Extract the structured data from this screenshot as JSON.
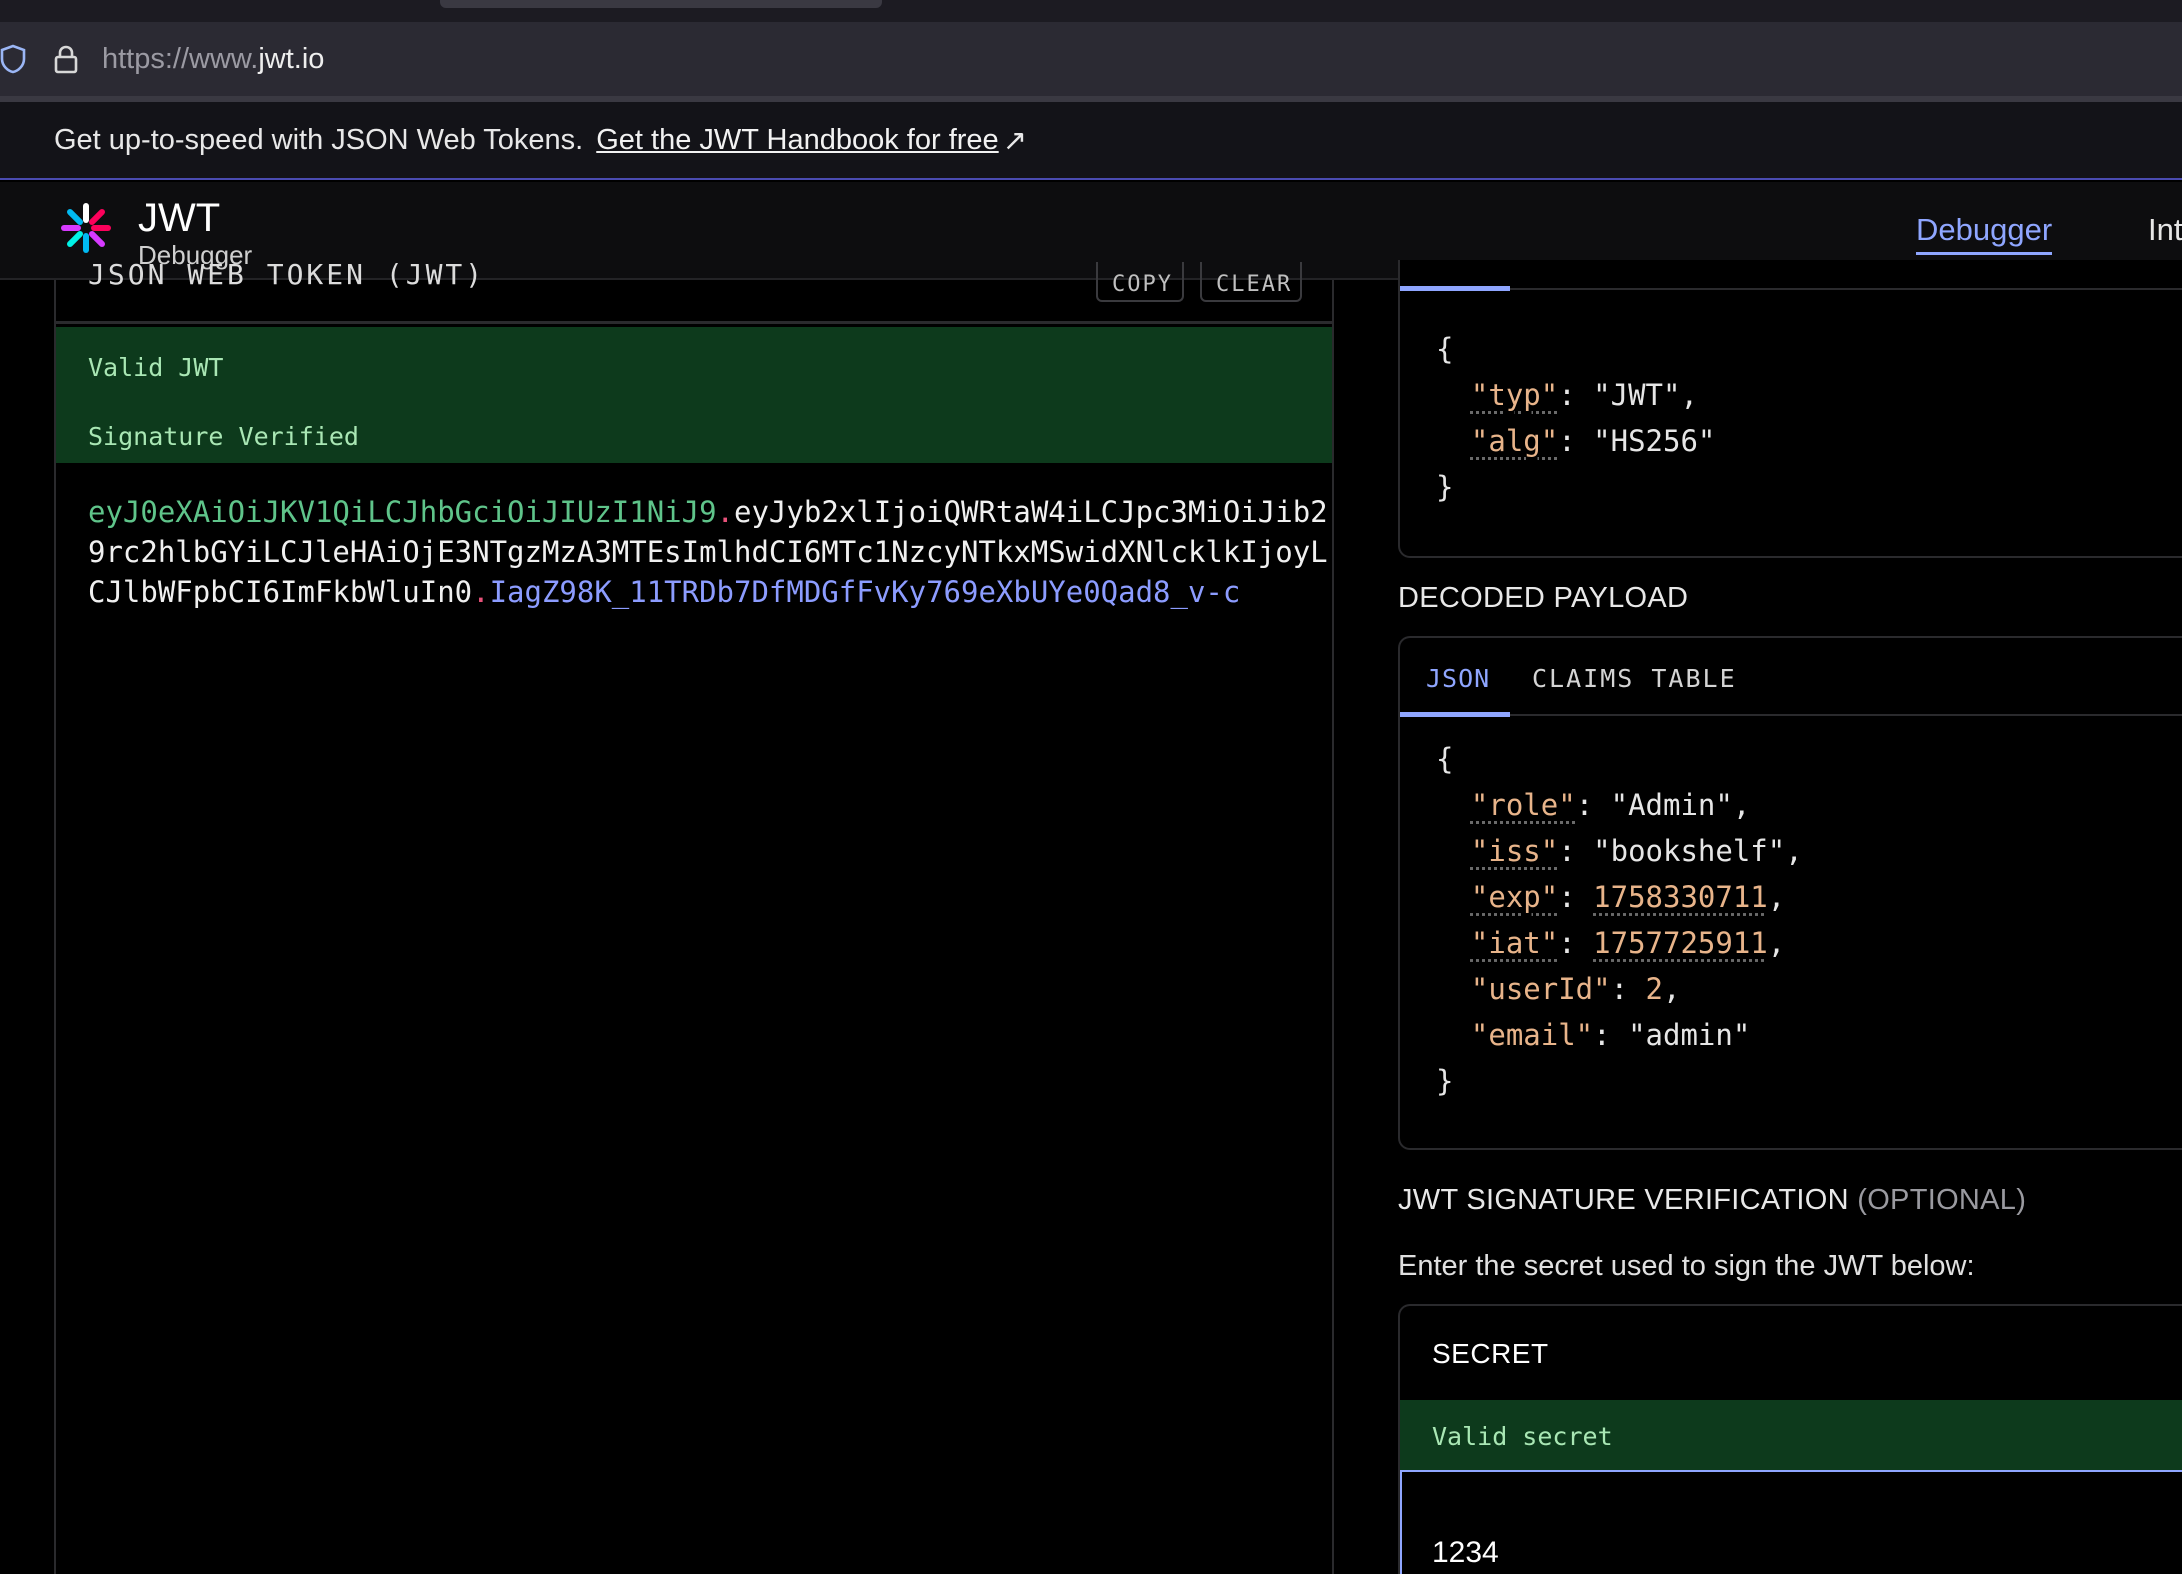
{
  "browser": {
    "url_prefix": "https://www.",
    "url_domain": "jwt.io",
    "icons": [
      "shield-icon",
      "lock-icon"
    ]
  },
  "banner": {
    "text": "Get up-to-speed with JSON Web Tokens.",
    "link": "Get the JWT Handbook for free",
    "arrow": "↗"
  },
  "header": {
    "brand_title": "JWT",
    "brand_subtitle": "Debugger",
    "nav": {
      "debugger": "Debugger",
      "next": "Int"
    }
  },
  "encoded": {
    "title": "JSON WEB TOKEN (JWT)",
    "copy_label": "COPY",
    "clear_label": "CLEAR",
    "status_valid": "Valid JWT",
    "status_signature": "Signature Verified",
    "token_line1_head": "eyJ0eXAiOiJKV1QiLCJhbGciOiJIUzI1NiJ9",
    "token_line1_dot": ".",
    "token_line1_payload": "eyJyb2xlIjoiQWRtaW4iLCJpc3MiOiJib2",
    "token_line2": "9rc2hlbGYiLCJleHAiOjE3NTgzMzA3MTEsImlhdCI6MTc1NzcyNTkxMSwidXNlcklkIjoyL",
    "token_line3_payload": "CJlbWFpbCI6ImFkbWluIn0",
    "token_line3_dot": ".",
    "token_line3_sig": "IagZ98K_11TRDb7DfMDGfFvKy769eXbUYe0Qad8_v-c"
  },
  "decoded_header": {
    "open": "{",
    "close": "}",
    "typ_key": "\"typ\"",
    "typ_val": "\"JWT\"",
    "alg_key": "\"alg\"",
    "alg_val": "\"HS256\""
  },
  "decoded_payload": {
    "label": "DECODED PAYLOAD",
    "tab_json": "JSON",
    "tab_claims": "CLAIMS TABLE",
    "open": "{",
    "close": "}",
    "role_key": "\"role\"",
    "role_val": "\"Admin\"",
    "iss_key": "\"iss\"",
    "iss_val": "\"bookshelf\"",
    "exp_key": "\"exp\"",
    "exp_val": "1758330711",
    "iat_key": "\"iat\"",
    "iat_val": "1757725911",
    "userid_key": "\"userId\"",
    "userid_val": "2",
    "email_key": "\"email\"",
    "email_val": "\"admin\""
  },
  "verification": {
    "label": "JWT SIGNATURE VERIFICATION",
    "optional": "(OPTIONAL)",
    "description": "Enter the secret used to sign the JWT below:",
    "secret_title": "SECRET",
    "secret_status": "Valid secret",
    "secret_value": "1234"
  },
  "colors": {
    "accent": "#8fa6ff",
    "valid_bg": "#0d3a1c",
    "valid_text": "#a9e7b4",
    "token_header": "#5fc48a",
    "token_signature": "#8c9cff",
    "token_dot": "#e8527a",
    "json_key": "#e8b48a"
  }
}
